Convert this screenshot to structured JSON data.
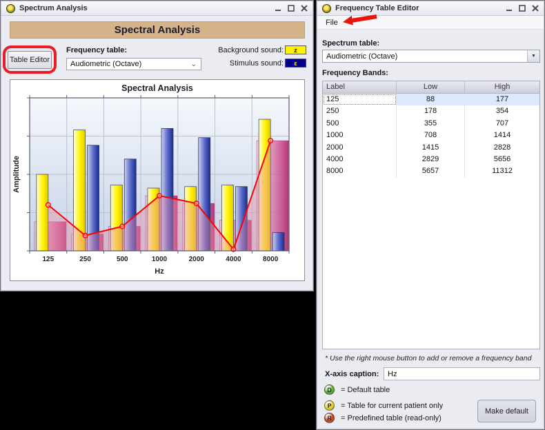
{
  "left_window": {
    "title": "Spectrum Analysis",
    "header_banner": "Spectral Analysis",
    "table_editor_button": "Table Editor",
    "frequency_table_label": "Frequency table:",
    "frequency_table_value": "Audiometric (Octave)",
    "background_sound_label": "Background sound:",
    "background_sound_symbol": "z",
    "stimulus_sound_label": "Stimulus sound:",
    "stimulus_sound_symbol": "ε",
    "colors": {
      "banner": "#D6B388",
      "background_swatch": "#FFF200",
      "stimulus_swatch": "#00008B",
      "annotation_red": "#ED1C24"
    }
  },
  "chart_data": {
    "type": "bar",
    "title": "Spectral Analysis",
    "xlabel": "Hz",
    "ylabel": "Amplitude",
    "categories": [
      "125",
      "250",
      "500",
      "1000",
      "2000",
      "4000",
      "8000"
    ],
    "ylim": [
      0,
      1
    ],
    "grid": true,
    "legend_position": "none",
    "series": [
      {
        "name": "background-sound-bars",
        "type": "bar",
        "color": "#FFF200",
        "values": [
          0.5,
          0.79,
          0.43,
          0.41,
          0.42,
          0.43,
          0.86
        ]
      },
      {
        "name": "stimulus-sound-bars",
        "type": "bar",
        "color": "#1A2A8E",
        "values": [
          0,
          0.69,
          0.6,
          0.8,
          0.74,
          0.42,
          0.12
        ]
      },
      {
        "name": "spectrum-wide-bars",
        "type": "bar",
        "color": "#C03078",
        "values": [
          0.19,
          0.11,
          0.16,
          0.36,
          0.31,
          0.2,
          0.72
        ]
      },
      {
        "name": "spectrum-line",
        "type": "line",
        "color": "#FF0000",
        "values": [
          0.3,
          0.1,
          0.16,
          0.36,
          0.31,
          0.01,
          0.72
        ]
      }
    ]
  },
  "right_window": {
    "title": "Frequency Table Editor",
    "menu_items": [
      "File"
    ],
    "spectrum_table_label": "Spectrum table:",
    "spectrum_table_value": "Audiometric (Octave)",
    "frequency_bands_label": "Frequency Bands:",
    "bands_table": {
      "columns": [
        "Label",
        "Low",
        "High"
      ],
      "rows": [
        {
          "label": "125",
          "low": "88",
          "high": "177"
        },
        {
          "label": "250",
          "low": "178",
          "high": "354"
        },
        {
          "label": "500",
          "low": "355",
          "high": "707"
        },
        {
          "label": "1000",
          "low": "708",
          "high": "1414"
        },
        {
          "label": "2000",
          "low": "1415",
          "high": "2828"
        },
        {
          "label": "4000",
          "low": "2829",
          "high": "5656"
        },
        {
          "label": "8000",
          "low": "5657",
          "high": "11312"
        }
      ],
      "selected_row_index": 0
    },
    "note": "* Use the right mouse button to add or remove a frequency band",
    "x_axis_caption_label": "X-axis caption:",
    "x_axis_caption_value": "Hz",
    "legend": [
      {
        "symbol": "D",
        "meaning": "= Default table",
        "color": "#52B41E"
      },
      {
        "symbol": "P",
        "meaning": "= Table for current patient only",
        "color": "#E8D020"
      },
      {
        "symbol": "R",
        "meaning": "= Predefined table (read-only)",
        "color": "#CC3A18"
      }
    ],
    "make_default_button": "Make default"
  }
}
